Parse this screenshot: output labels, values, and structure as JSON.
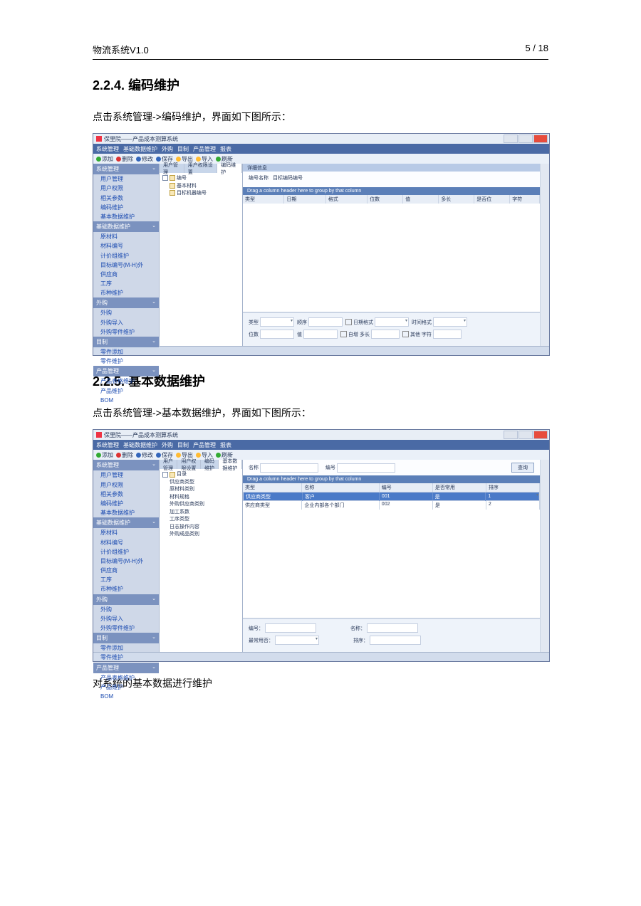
{
  "doc": {
    "header_left": "物流系统V1.0",
    "header_right": "5 / 18",
    "section1_no": "2.2.4.",
    "section1_title": "编码维护",
    "section1_intro": "点击系统管理->编码维护，界面如下图所示：",
    "section2_no": "2.2.5.",
    "section2_title": "基本数据维护",
    "section2_intro": "点击系统管理->基本数据维护，界面如下图所示：",
    "footer_para": "对系统的基本数据进行维护"
  },
  "app": {
    "window_title": "保里院——产品成本测算系统",
    "menu": [
      "系统管理",
      "基础数据维护",
      "外购",
      "目制",
      "产品管理",
      "报表"
    ],
    "toolbar": [
      "添加",
      "删除",
      "修改",
      "保存",
      "导出",
      "导入",
      "刷新"
    ]
  },
  "nav": {
    "g1_title": "系统管理",
    "g1": [
      "用户管理",
      "用户权限",
      "相关参数",
      "编码维护",
      "基本数据维护"
    ],
    "g2_title": "基础数据维护",
    "g2": [
      "原材料",
      "材料编号",
      "计价组维护",
      "目标编号(M-H)外",
      "供应商",
      "工序",
      "币种维护"
    ],
    "g3_title": "外购",
    "g3": [
      "外购",
      "外购导入",
      "外购零件维护"
    ],
    "g4_title": "目制",
    "g4": [
      "零件添加",
      "零件维护"
    ],
    "g5_title": "产品管理",
    "g5": [
      "产品表格维护",
      "产品维护",
      "BOM"
    ]
  },
  "shot1": {
    "tabs": [
      "用户管理",
      "用户权限设置",
      "编码维护"
    ],
    "active_tab": "编码维护",
    "sub_bar": "详细信息",
    "tree_root": "编号",
    "tree": [
      "基本材料",
      "目标机器编号"
    ],
    "info_label": "编号名称",
    "info_value": "目标编码编号",
    "grid_hint": "Drag a column header here to group by that column",
    "cols": [
      "类型",
      "日期",
      "格式",
      "位数",
      "值",
      "多长",
      "是否位",
      "字符"
    ],
    "form": {
      "type": "类型",
      "seq": "顺序",
      "datefmt": "日期格式",
      "timefmt": "时间格式",
      "digits": "位数",
      "val": "值",
      "autolen": "自增 多长",
      "otherchar": "其他 字符"
    }
  },
  "shot2": {
    "tabs": [
      "用户管理",
      "用户权限设置",
      "编码维护",
      "基本数据维护"
    ],
    "active_tab": "基本数据维护",
    "tree_root": "目录",
    "tree": [
      "供应商类型",
      "原材料类别",
      "材料规格",
      "外购供应商类别",
      "加工系数",
      "工序类型",
      "日志操作内容",
      "外购成品类别"
    ],
    "search_name": "名称",
    "search_no": "编号",
    "search_btn": "查询",
    "grid_hint": "Drag a column header here to group by that column",
    "cols": [
      "类型",
      "名称",
      "编号",
      "是否常用",
      "排序"
    ],
    "row1": {
      "type": "供应商类型",
      "name": "客户",
      "no": "001",
      "used": "是",
      "sort": "1"
    },
    "row2": {
      "type": "供应商类型",
      "name": "企业内部各个部门",
      "no": "002",
      "used": "是",
      "sort": "2"
    },
    "form": {
      "no": "编号：",
      "name": "名称：",
      "common": "最常用否：",
      "sort": "排序："
    }
  }
}
